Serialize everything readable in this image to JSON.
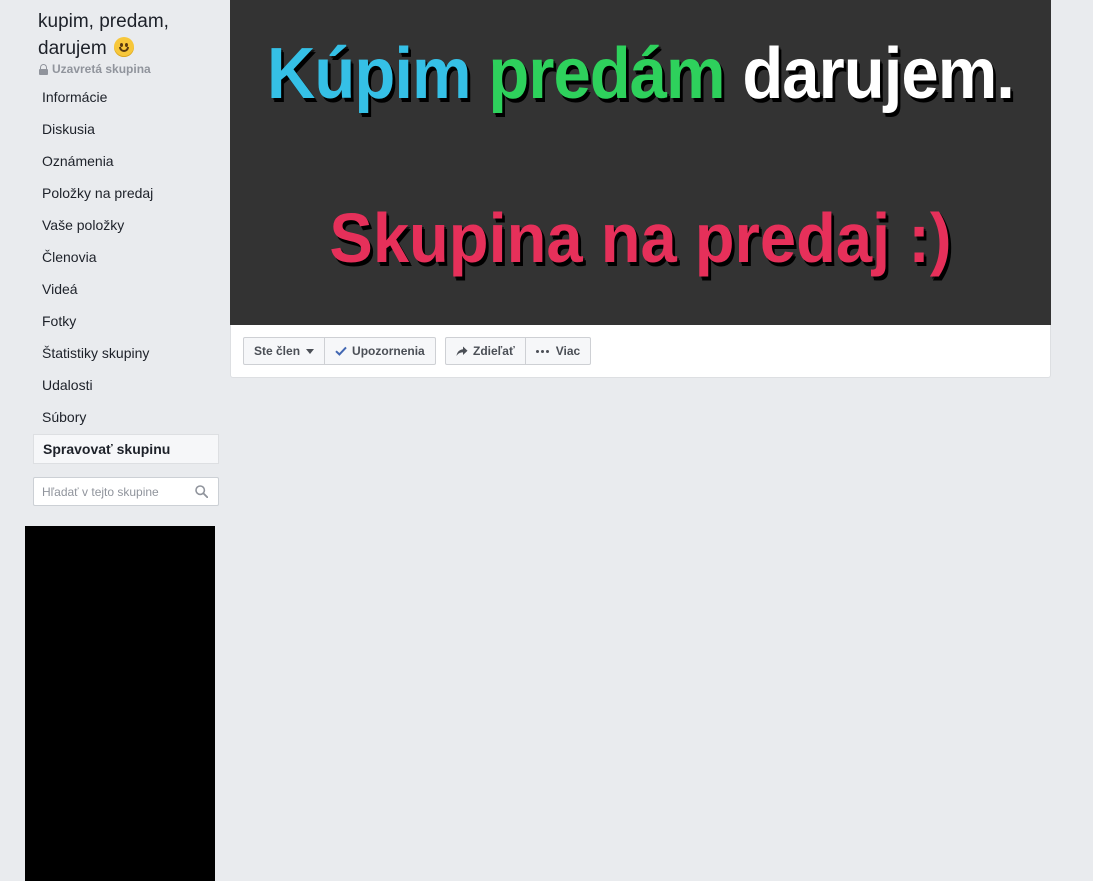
{
  "group": {
    "name": "kupim, predam, darujem",
    "emoji": "smiling-face-icon",
    "privacy_label": "Uzavretá skupina"
  },
  "sidebar": {
    "items": [
      {
        "label": "Informácie"
      },
      {
        "label": "Diskusia"
      },
      {
        "label": "Oznámenia"
      },
      {
        "label": "Položky na predaj"
      },
      {
        "label": "Vaše položky"
      },
      {
        "label": "Členovia"
      },
      {
        "label": "Videá"
      },
      {
        "label": "Fotky"
      },
      {
        "label": "Štatistiky skupiny"
      },
      {
        "label": "Udalosti"
      },
      {
        "label": "Súbory"
      },
      {
        "label": "Spravovať skupinu",
        "active": true
      }
    ]
  },
  "search": {
    "placeholder": "Hľadať v tejto skupine",
    "value": ""
  },
  "cover": {
    "line1_word1": "Kúpim",
    "line1_word2": "predám",
    "line1_word3": "darujem.",
    "line2": "Skupina na predaj :)",
    "colors": {
      "background": "#333333",
      "word1": "#35c0e6",
      "word2": "#2ed15c",
      "word3": "#ffffff",
      "line2": "#e6305a"
    }
  },
  "actions": {
    "member_label": "Ste člen",
    "notifications_label": "Upozornenia",
    "share_label": "Zdieľať",
    "more_label": "Viac"
  },
  "colors": {
    "page_background": "#e9ebee",
    "check_accent": "#4267b2"
  }
}
